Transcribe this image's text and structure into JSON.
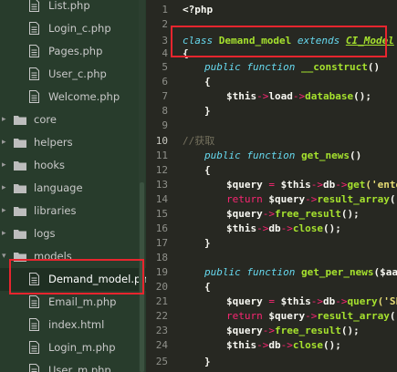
{
  "sidebar": {
    "items": [
      {
        "type": "file",
        "label": "List.php"
      },
      {
        "type": "file",
        "label": "Login_c.php"
      },
      {
        "type": "file",
        "label": "Pages.php"
      },
      {
        "type": "file",
        "label": "User_c.php"
      },
      {
        "type": "file",
        "label": "Welcome.php"
      },
      {
        "type": "folder",
        "label": "core"
      },
      {
        "type": "folder",
        "label": "helpers"
      },
      {
        "type": "folder",
        "label": "hooks"
      },
      {
        "type": "folder",
        "label": "language"
      },
      {
        "type": "folder",
        "label": "libraries"
      },
      {
        "type": "folder",
        "label": "logs"
      },
      {
        "type": "folder-open",
        "label": "models"
      },
      {
        "type": "file",
        "label": "Demand_model.php",
        "selected": true
      },
      {
        "type": "file",
        "label": "Email_m.php"
      },
      {
        "type": "file",
        "label": "index.html"
      },
      {
        "type": "file",
        "label": "Login_m.php"
      },
      {
        "type": "file",
        "label": "User_m.php"
      }
    ]
  },
  "editor": {
    "line_numbers": [
      "1",
      "2",
      "3",
      "4",
      "5",
      "6",
      "7",
      "8",
      "9",
      "10",
      "11",
      "12",
      "13",
      "14",
      "15",
      "16",
      "17",
      "18",
      "19",
      "20",
      "21",
      "22",
      "23",
      "24",
      "25"
    ],
    "code": {
      "l1": "<?php",
      "l3_class": "class",
      "l3_name": "Demand_model",
      "l3_extends": "extends",
      "l3_parent": "CI_Model",
      "l4": "{",
      "l5_public": "public",
      "l5_function": "function",
      "l5_name": "__construct",
      "l5_rest": "()",
      "l6": "{",
      "l7_this": "$this",
      "l7_arrow1": "->",
      "l7_load": "load",
      "l7_arrow2": "->",
      "l7_fn": "database",
      "l7_rest": "();",
      "l8": "}",
      "l10_comment": "//获取",
      "l11_public": "public",
      "l11_function": "function",
      "l11_name": "get_news",
      "l11_rest": "()",
      "l12": "{",
      "l13_var": "$query",
      "l13_eq": " = ",
      "l13_this": "$this",
      "l13_a1": "->",
      "l13_db": "db",
      "l13_a2": "->",
      "l13_fn": "get",
      "l13_str": "('enterp",
      "l14_return": "return",
      "l14_var": " $query",
      "l14_a": "->",
      "l14_fn": "result_array",
      "l14_rest": "();",
      "l15_var": "$query",
      "l15_a": "->",
      "l15_fn": "free_result",
      "l15_rest": "();",
      "l16_this": "$this",
      "l16_a1": "->",
      "l16_db": "db",
      "l16_a2": "->",
      "l16_fn": "close",
      "l16_rest": "();",
      "l17": "}",
      "l19_public": "public",
      "l19_function": "function",
      "l19_name": "get_per_news",
      "l19_rest": "($aaa,",
      "l20": "{",
      "l21_var": "$query",
      "l21_eq": " = ",
      "l21_this": "$this",
      "l21_a1": "->",
      "l21_db": "db",
      "l21_a2": "->",
      "l21_fn": "query",
      "l21_str": "('SELE",
      "l22_return": "return",
      "l22_var": " $query",
      "l22_a": "->",
      "l22_fn": "result_array",
      "l22_rest": "();",
      "l23_var": "$query",
      "l23_a": "->",
      "l23_fn": "free_result",
      "l23_rest": "();",
      "l24_this": "$this",
      "l24_a1": "->",
      "l24_db": "db",
      "l24_a2": "->",
      "l24_fn": "close",
      "l24_rest": "();",
      "l25": "}"
    }
  },
  "colors": {
    "highlight_box": "#e8252e",
    "sidebar_bg": "#283c2c",
    "editor_bg": "#272822"
  }
}
